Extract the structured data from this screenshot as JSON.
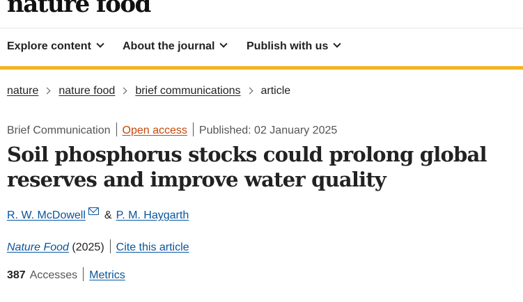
{
  "header": {
    "logo_text": "nature food"
  },
  "nav": {
    "items": [
      {
        "label": "Explore content"
      },
      {
        "label": "About the journal"
      },
      {
        "label": "Publish with us"
      }
    ]
  },
  "colors": {
    "accent": "#f4b223",
    "link": "#06549d",
    "open_access": "#c4470b"
  },
  "breadcrumb": {
    "items": [
      "nature",
      "nature food",
      "brief communications"
    ],
    "current": "article"
  },
  "article": {
    "type": "Brief Communication",
    "access": "Open access",
    "published": "Published: 02 January 2025",
    "title": "Soil phosphorus stocks could prolong global reserves and improve water quality",
    "authors": [
      "R. W. McDowell",
      "P. M. Haygarth"
    ],
    "author_separator": "&",
    "journal": "Nature Food",
    "year": "(2025)",
    "cite_label": "Cite this article",
    "accesses_count": "387",
    "accesses_label": "Accesses",
    "metrics_label": "Metrics"
  },
  "icons": {
    "nav_chevron": "chevron-down-icon",
    "breadcrumb_separator": "chevron-right-icon",
    "author_contact": "mail-icon"
  }
}
